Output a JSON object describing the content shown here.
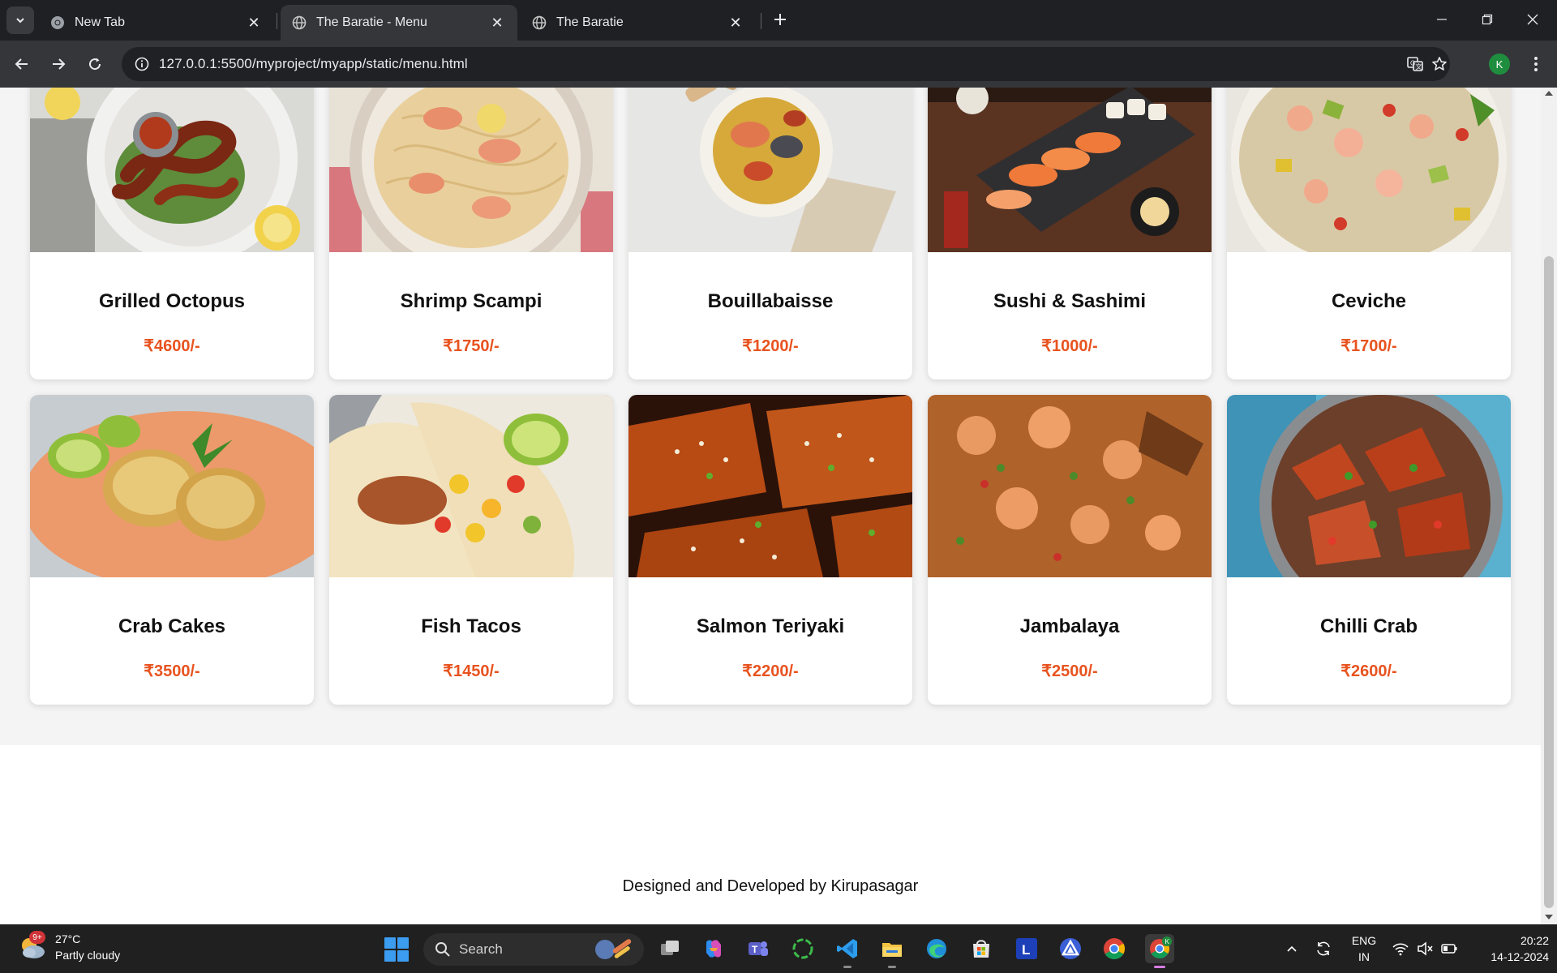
{
  "browser": {
    "tabs": [
      {
        "title": "New Tab",
        "active": false
      },
      {
        "title": "The Baratie - Menu",
        "active": true
      },
      {
        "title": "The Baratie",
        "active": false
      }
    ],
    "url": "127.0.0.1:5500/myproject/myapp/static/menu.html",
    "profile_initial": "K"
  },
  "menu": {
    "items": [
      {
        "name": "Grilled Octopus",
        "price": "₹4600/-"
      },
      {
        "name": "Shrimp Scampi",
        "price": "₹1750/-"
      },
      {
        "name": "Bouillabaisse",
        "price": "₹1200/-"
      },
      {
        "name": "Sushi & Sashimi",
        "price": "₹1000/-"
      },
      {
        "name": "Ceviche",
        "price": "₹1700/-"
      },
      {
        "name": "Crab Cakes",
        "price": "₹3500/-"
      },
      {
        "name": "Fish Tacos",
        "price": "₹1450/-"
      },
      {
        "name": "Salmon Teriyaki",
        "price": "₹2200/-"
      },
      {
        "name": "Jambalaya",
        "price": "₹2500/-"
      },
      {
        "name": "Chilli Crab",
        "price": "₹2600/-"
      }
    ],
    "price_color": "#e8531f"
  },
  "footer": {
    "text": "Designed and Developed by Kirupasagar"
  },
  "taskbar": {
    "weather": {
      "temp": "27°C",
      "condition": "Partly cloudy",
      "badge": "9+"
    },
    "search_label": "Search",
    "language": {
      "line1": "ENG",
      "line2": "IN"
    },
    "clock": {
      "time": "20:22",
      "date": "14-12-2024"
    },
    "pinned_icons": [
      "task-view-icon",
      "copilot-icon",
      "teams-icon",
      "circle-app-icon",
      "vscode-icon",
      "file-explorer-icon",
      "edge-icon",
      "microsoft-store-icon",
      "l-app-icon",
      "triangle-app-icon",
      "chrome-icon",
      "chrome-profile-icon"
    ]
  }
}
